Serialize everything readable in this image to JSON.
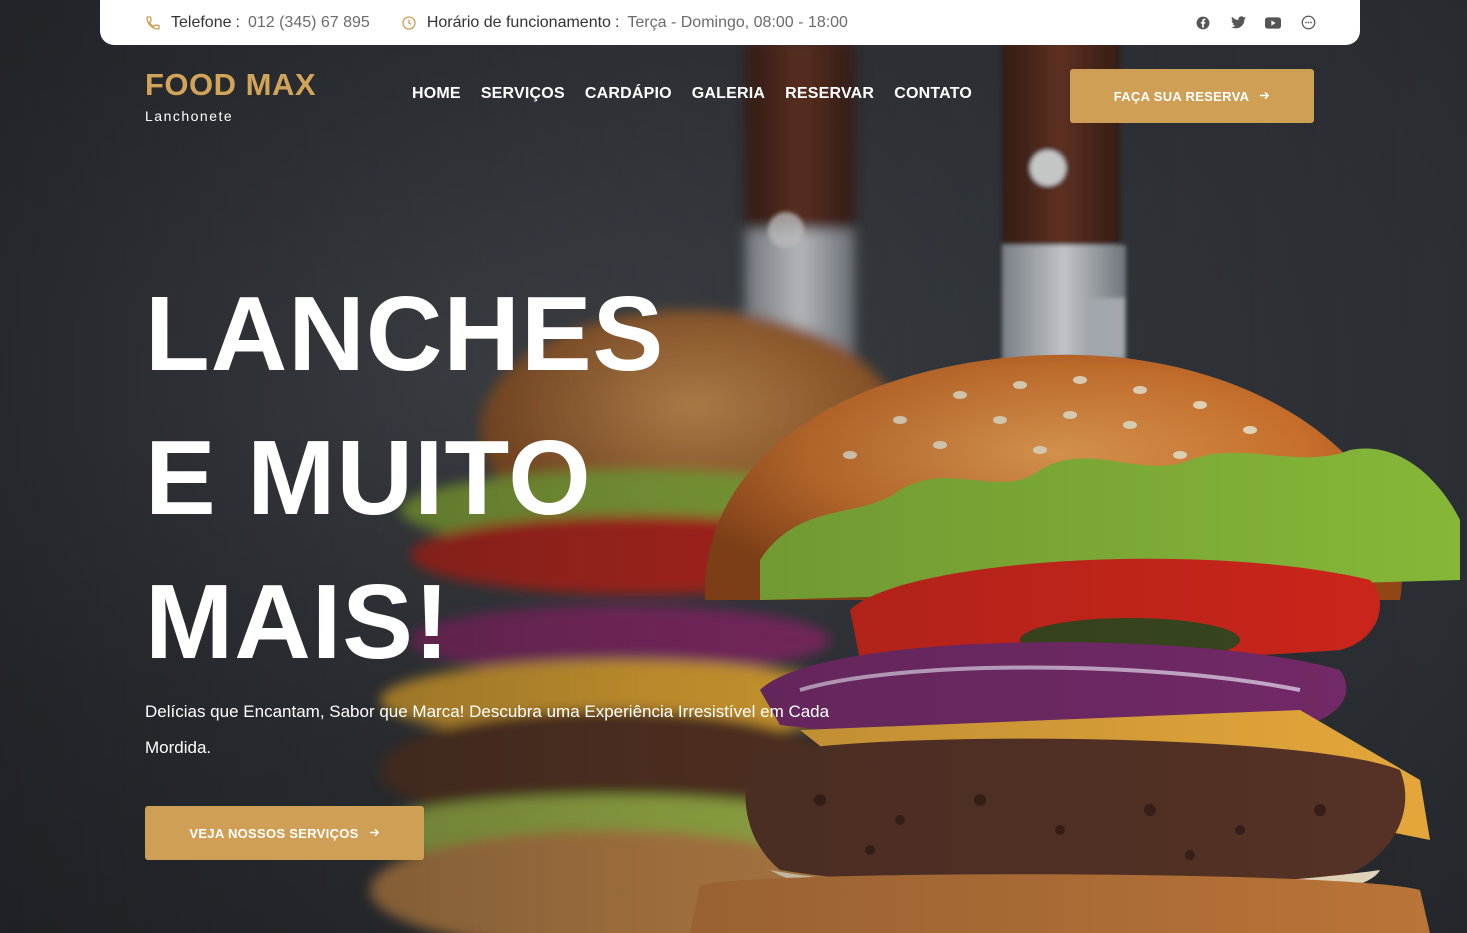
{
  "topbar": {
    "phone_label": "Telefone",
    "phone_value": "012 (345) 67 895",
    "hours_label": "Horário de funcionamento",
    "hours_value": "Terça - Domingo, 08:00 - 18:00",
    "separator": ":",
    "icons": [
      "phone-icon",
      "clock-icon"
    ],
    "socials": [
      "facebook-icon",
      "twitter-icon",
      "youtube-icon",
      "chat-icon"
    ]
  },
  "brand": {
    "name": "FOOD MAX",
    "tagline": "Lanchonete"
  },
  "nav": {
    "items": [
      "HOME",
      "SERVIÇOS",
      "CARDÁPIO",
      "GALERIA",
      "RESERVAR",
      "CONTATO"
    ]
  },
  "header_cta": {
    "label": "FAÇA SUA RESERVA",
    "icon": "arrow-right-icon"
  },
  "hero": {
    "title_lines": [
      "LANCHES",
      "E MUITO",
      "MAIS!"
    ],
    "subtitle": "Delícias que Encantam, Sabor que Marca! Descubra uma Experiência Irresistível em Cada Mordida.",
    "cta_label": "VEJA NOSSOS SERVIÇOS",
    "cta_icon": "arrow-right-icon"
  },
  "colors": {
    "accent": "#cf9f55",
    "brand_gold": "#d2a459",
    "text_white": "#ffffff",
    "topbar_bg": "#ffffff"
  }
}
